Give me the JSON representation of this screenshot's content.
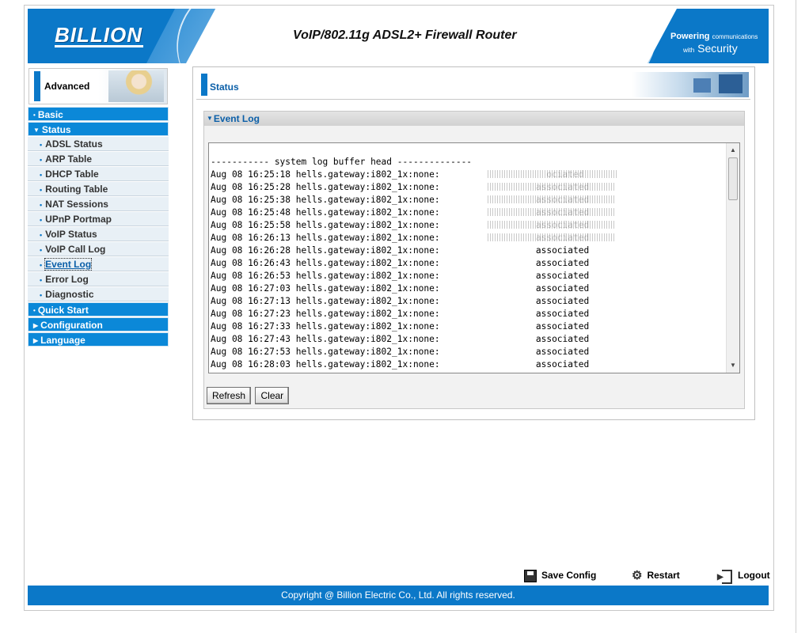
{
  "header": {
    "logo": "BILLION",
    "product_title": "VoIP/802.11g ADSL2+ Firewall Router",
    "tagline_word1": "Powering",
    "tagline_small1": "communications",
    "tagline_small2": "with",
    "tagline_word2": "Security"
  },
  "sidebar": {
    "section_label": "Advanced",
    "menu": [
      {
        "label": "Basic"
      },
      {
        "label": "Status"
      },
      {
        "label": "Quick Start"
      },
      {
        "label": "Configuration"
      },
      {
        "label": "Language"
      }
    ],
    "status_items": [
      {
        "label": "ADSL Status"
      },
      {
        "label": "ARP Table"
      },
      {
        "label": "DHCP Table"
      },
      {
        "label": "Routing Table"
      },
      {
        "label": "NAT Sessions"
      },
      {
        "label": "UPnP Portmap"
      },
      {
        "label": "VoIP Status"
      },
      {
        "label": "VoIP Call Log"
      },
      {
        "label": "Event Log"
      },
      {
        "label": "Error Log"
      },
      {
        "label": "Diagnostic"
      }
    ]
  },
  "main": {
    "page_title": "Status",
    "section_title": "Event Log",
    "log": {
      "header_line": "----------- system log buffer head --------------",
      "lines": [
        "Aug 08 16:25:18 hells.gateway:i802_1x:none:                    ociated",
        "Aug 08 16:25:28 hells.gateway:i802_1x:none:                  associated",
        "Aug 08 16:25:38 hells.gateway:i802_1x:none:                  associated",
        "Aug 08 16:25:48 hells.gateway:i802_1x:none:                  associated",
        "Aug 08 16:25:58 hells.gateway:i802_1x:none:                  associated",
        "Aug 08 16:26:13 hells.gateway:i802_1x:none:                  associated",
        "Aug 08 16:26:28 hells.gateway:i802_1x:none:                  associated",
        "Aug 08 16:26:43 hells.gateway:i802_1x:none:                  associated",
        "Aug 08 16:26:53 hells.gateway:i802_1x:none:                  associated",
        "Aug 08 16:27:03 hells.gateway:i802_1x:none:                  associated",
        "Aug 08 16:27:13 hells.gateway:i802_1x:none:                  associated",
        "Aug 08 16:27:23 hells.gateway:i802_1x:none:                  associated",
        "Aug 08 16:27:33 hells.gateway:i802_1x:none:                  associated",
        "Aug 08 16:27:43 hells.gateway:i802_1x:none:                  associated",
        "Aug 08 16:27:53 hells.gateway:i802_1x:none:                  associated",
        "Aug 08 16:28:03 hells.gateway:i802_1x:none:                  associated"
      ]
    },
    "buttons": {
      "refresh": "Refresh",
      "clear": "Clear"
    }
  },
  "actions": {
    "save_config": "Save Config",
    "restart": "Restart",
    "logout": "Logout"
  },
  "footer": {
    "copyright": "Copyright @ Billion Electric Co., Ltd. All rights reserved."
  },
  "colors": {
    "brand_blue": "#0b78c8",
    "link_blue": "#0b5fa8"
  }
}
